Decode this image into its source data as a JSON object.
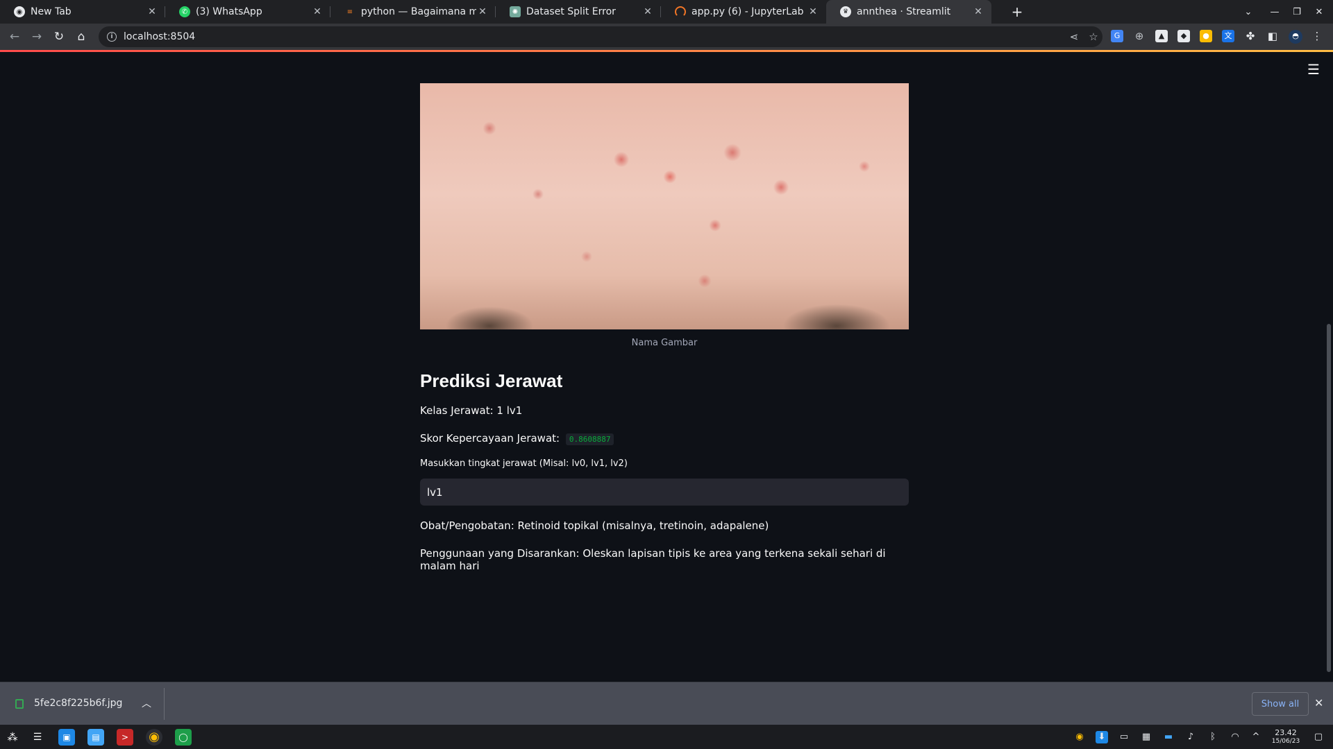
{
  "browser": {
    "tabs": [
      {
        "label": "New Tab",
        "icon": "chrome-icon",
        "active": false
      },
      {
        "label": "(3) WhatsApp",
        "icon": "whatsapp-icon",
        "active": false
      },
      {
        "label": "python — Bagaimana menen",
        "icon": "stackoverflow-icon",
        "active": false
      },
      {
        "label": "Dataset Split Error",
        "icon": "chatgpt-icon",
        "active": false
      },
      {
        "label": "app.py (6) - JupyterLab",
        "icon": "jupyter-icon",
        "active": false
      },
      {
        "label": "annthea · Streamlit",
        "icon": "streamlit-icon",
        "active": true
      }
    ],
    "url": "localhost:8504"
  },
  "app": {
    "image_caption": "Nama Gambar",
    "heading": "Prediksi Jerawat",
    "class_line": "Kelas Jerawat: 1 lv1",
    "score_label": "Skor Kepercayaan Jerawat:",
    "score_value": "0.8608887",
    "input_label": "Masukkan tingkat jerawat (Misal: lv0, lv1, lv2)",
    "input_value": "lv1",
    "medicine_line": "Obat/Pengobatan: Retinoid topikal (misalnya, tretinoin, adapalene)",
    "usage_line": "Penggunaan yang Disarankan: Oleskan lapisan tipis ke area yang terkena sekali sehari di malam hari"
  },
  "download_shelf": {
    "filename": "5fe2c8f225b6f.jpg",
    "show_all": "Show all"
  },
  "taskbar": {
    "time": "23.42",
    "date": "15/06/23"
  },
  "colors": {
    "app_bg": "#0e1117",
    "accent_green": "#09ab3b",
    "input_bg": "#262730",
    "link_blue": "#8ab4f8"
  }
}
